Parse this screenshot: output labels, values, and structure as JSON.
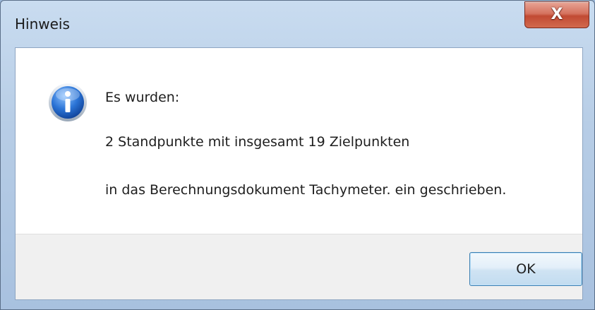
{
  "window": {
    "title": "Hinweis",
    "close_glyph": "X"
  },
  "message": {
    "icon": "info-icon",
    "lines": [
      "Es wurden:",
      "2 Standpunkte mit insgesamt 19 Zielpunkten",
      "in das Berechnungsdokument Tachymeter. ein geschrieben."
    ]
  },
  "buttons": {
    "ok_label": "OK"
  },
  "colors": {
    "close_button": "#c14a33",
    "info_icon": "#1f62c2",
    "ok_border": "#3c7fb1"
  }
}
